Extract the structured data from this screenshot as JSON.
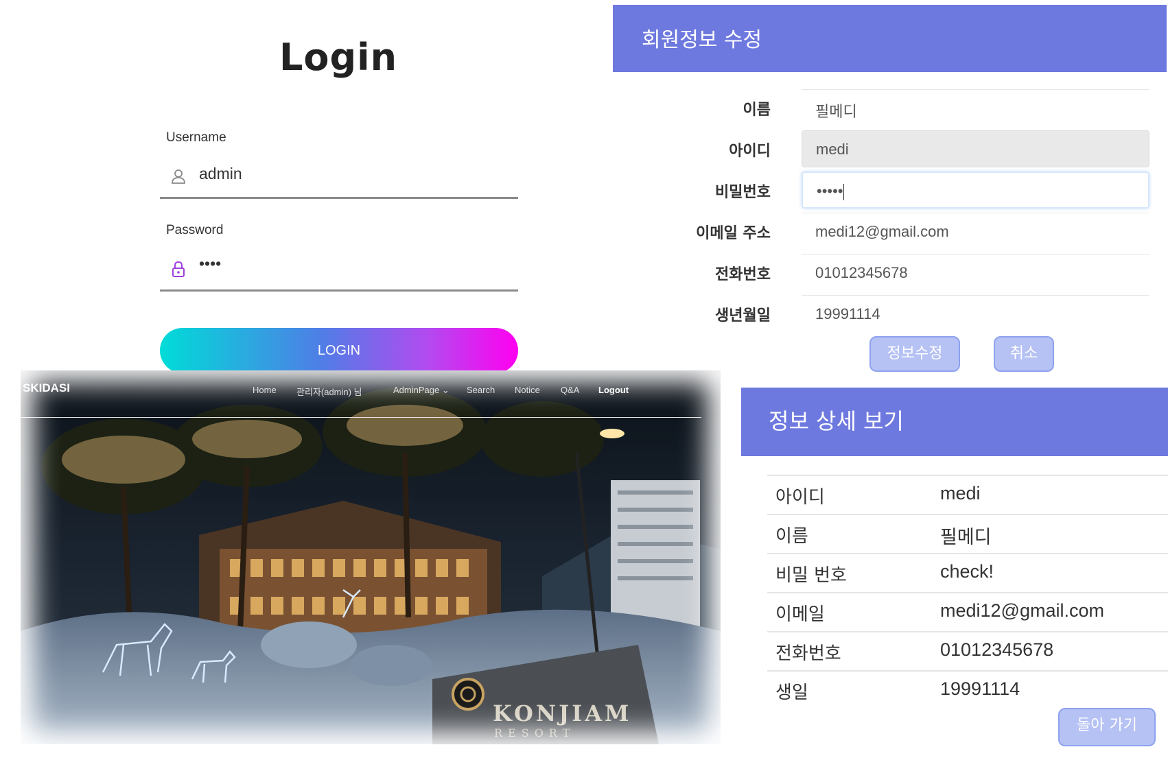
{
  "login": {
    "title": "Login",
    "username_label": "Username",
    "username_value": "admin",
    "password_label": "Password",
    "password_value": "••••",
    "button": "LOGIN"
  },
  "site": {
    "logo": "SKIDASI",
    "nav": {
      "home": "Home",
      "user": "관리자(admin) 님",
      "admin": "AdminPage",
      "search": "Search",
      "notice": "Notice",
      "qa": "Q&A",
      "logout": "Logout"
    },
    "sign_main": "KONJIAM",
    "sign_sub": "RESORT"
  },
  "edit": {
    "title": "회원정보 수정",
    "labels": {
      "name": "이름",
      "id": "아이디",
      "password": "비밀번호",
      "email": "이메일 주소",
      "phone": "전화번호",
      "birth": "생년월일"
    },
    "values": {
      "name": "필메디",
      "id": "medi",
      "password": "•••••",
      "email": "medi12@gmail.com",
      "phone": "01012345678",
      "birth": "19991114"
    },
    "submit": "정보수정",
    "cancel": "취소"
  },
  "detail": {
    "title": "정보 상세 보기",
    "rows": [
      {
        "k": "아이디",
        "v": "medi"
      },
      {
        "k": "이름",
        "v": "필메디"
      },
      {
        "k": "비밀 번호",
        "v": "check!"
      },
      {
        "k": "이메일",
        "v": "medi12@gmail.com"
      },
      {
        "k": "전화번호",
        "v": "01012345678"
      },
      {
        "k": "생일",
        "v": "19991114"
      }
    ],
    "back": "돌아 가기"
  },
  "colors": {
    "panel_header": "#6e79df",
    "button_light": "#b6c2f4",
    "gradient_start": "#00dcd8",
    "gradient_end": "#ff00f0",
    "lock_icon": "#a040e0"
  }
}
